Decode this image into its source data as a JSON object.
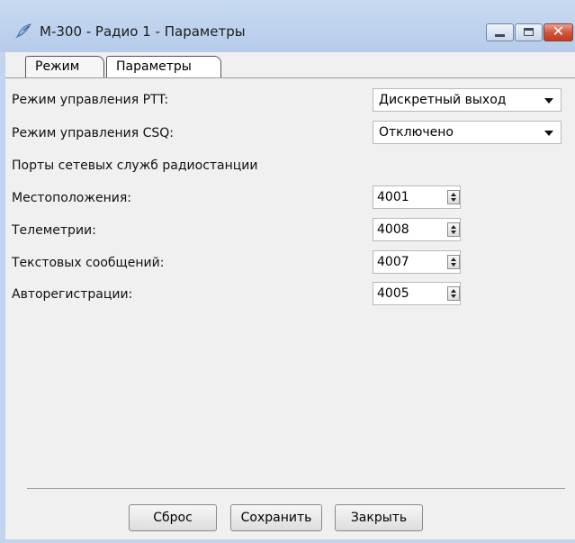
{
  "window": {
    "title": "М-300 - Радио 1 - Параметры",
    "icons": {
      "app": "satellite-dish-icon",
      "minimize": "minimize-icon",
      "maximize": "maximize-icon",
      "close": "close-icon"
    },
    "close_glyph": "✕"
  },
  "tabs": [
    {
      "label": "Режим",
      "active": false
    },
    {
      "label": "Параметры",
      "active": true
    }
  ],
  "form": {
    "ptt": {
      "label": "Режим управления PTT:",
      "value": "Дискретный выход"
    },
    "csq": {
      "label": "Режим управления CSQ:",
      "value": "Отключено"
    },
    "ports_heading": "Порты сетевых служб радиостанции",
    "ports": [
      {
        "label": "Местоположения:",
        "value": "4001"
      },
      {
        "label": "Телеметрии:",
        "value": "4008"
      },
      {
        "label": "Текстовых сообщений:",
        "value": "4007"
      },
      {
        "label": "Авторегистрации:",
        "value": "4005"
      }
    ]
  },
  "buttons": {
    "reset": "Сброс",
    "save": "Сохранить",
    "close": "Закрыть"
  },
  "colors": {
    "titlebar": "#bfd3ee",
    "client_bg": "#f0f0f0",
    "close_button": "#c23a22"
  }
}
